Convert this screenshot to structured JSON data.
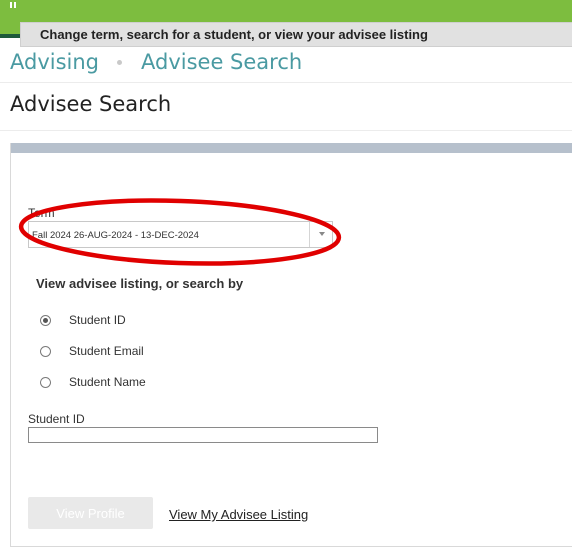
{
  "header": {
    "brand_color": "#7dbd3f",
    "accent_line_color": "#1e5a3b",
    "menu_icon": "grid-menu-icon"
  },
  "breadcrumb": {
    "items": [
      "Advising",
      "Advisee Search"
    ]
  },
  "page": {
    "title": "Advisee Search"
  },
  "form": {
    "section_title": "Change term, search for a student, or view your advisee listing",
    "term_label": "Term",
    "term_value": "Fall 2024 26-AUG-2024 - 13-DEC-2024",
    "search_by_title": "View advisee listing, or search by",
    "options": [
      {
        "label": "Student ID",
        "checked": true
      },
      {
        "label": "Student Email",
        "checked": false
      },
      {
        "label": "Student Name",
        "checked": false
      }
    ],
    "input_label": "Student ID",
    "input_value": "",
    "view_profile_label": "View Profile",
    "view_listing_label": "View My Advisee Listing"
  },
  "annotation": {
    "color": "#e00000"
  }
}
